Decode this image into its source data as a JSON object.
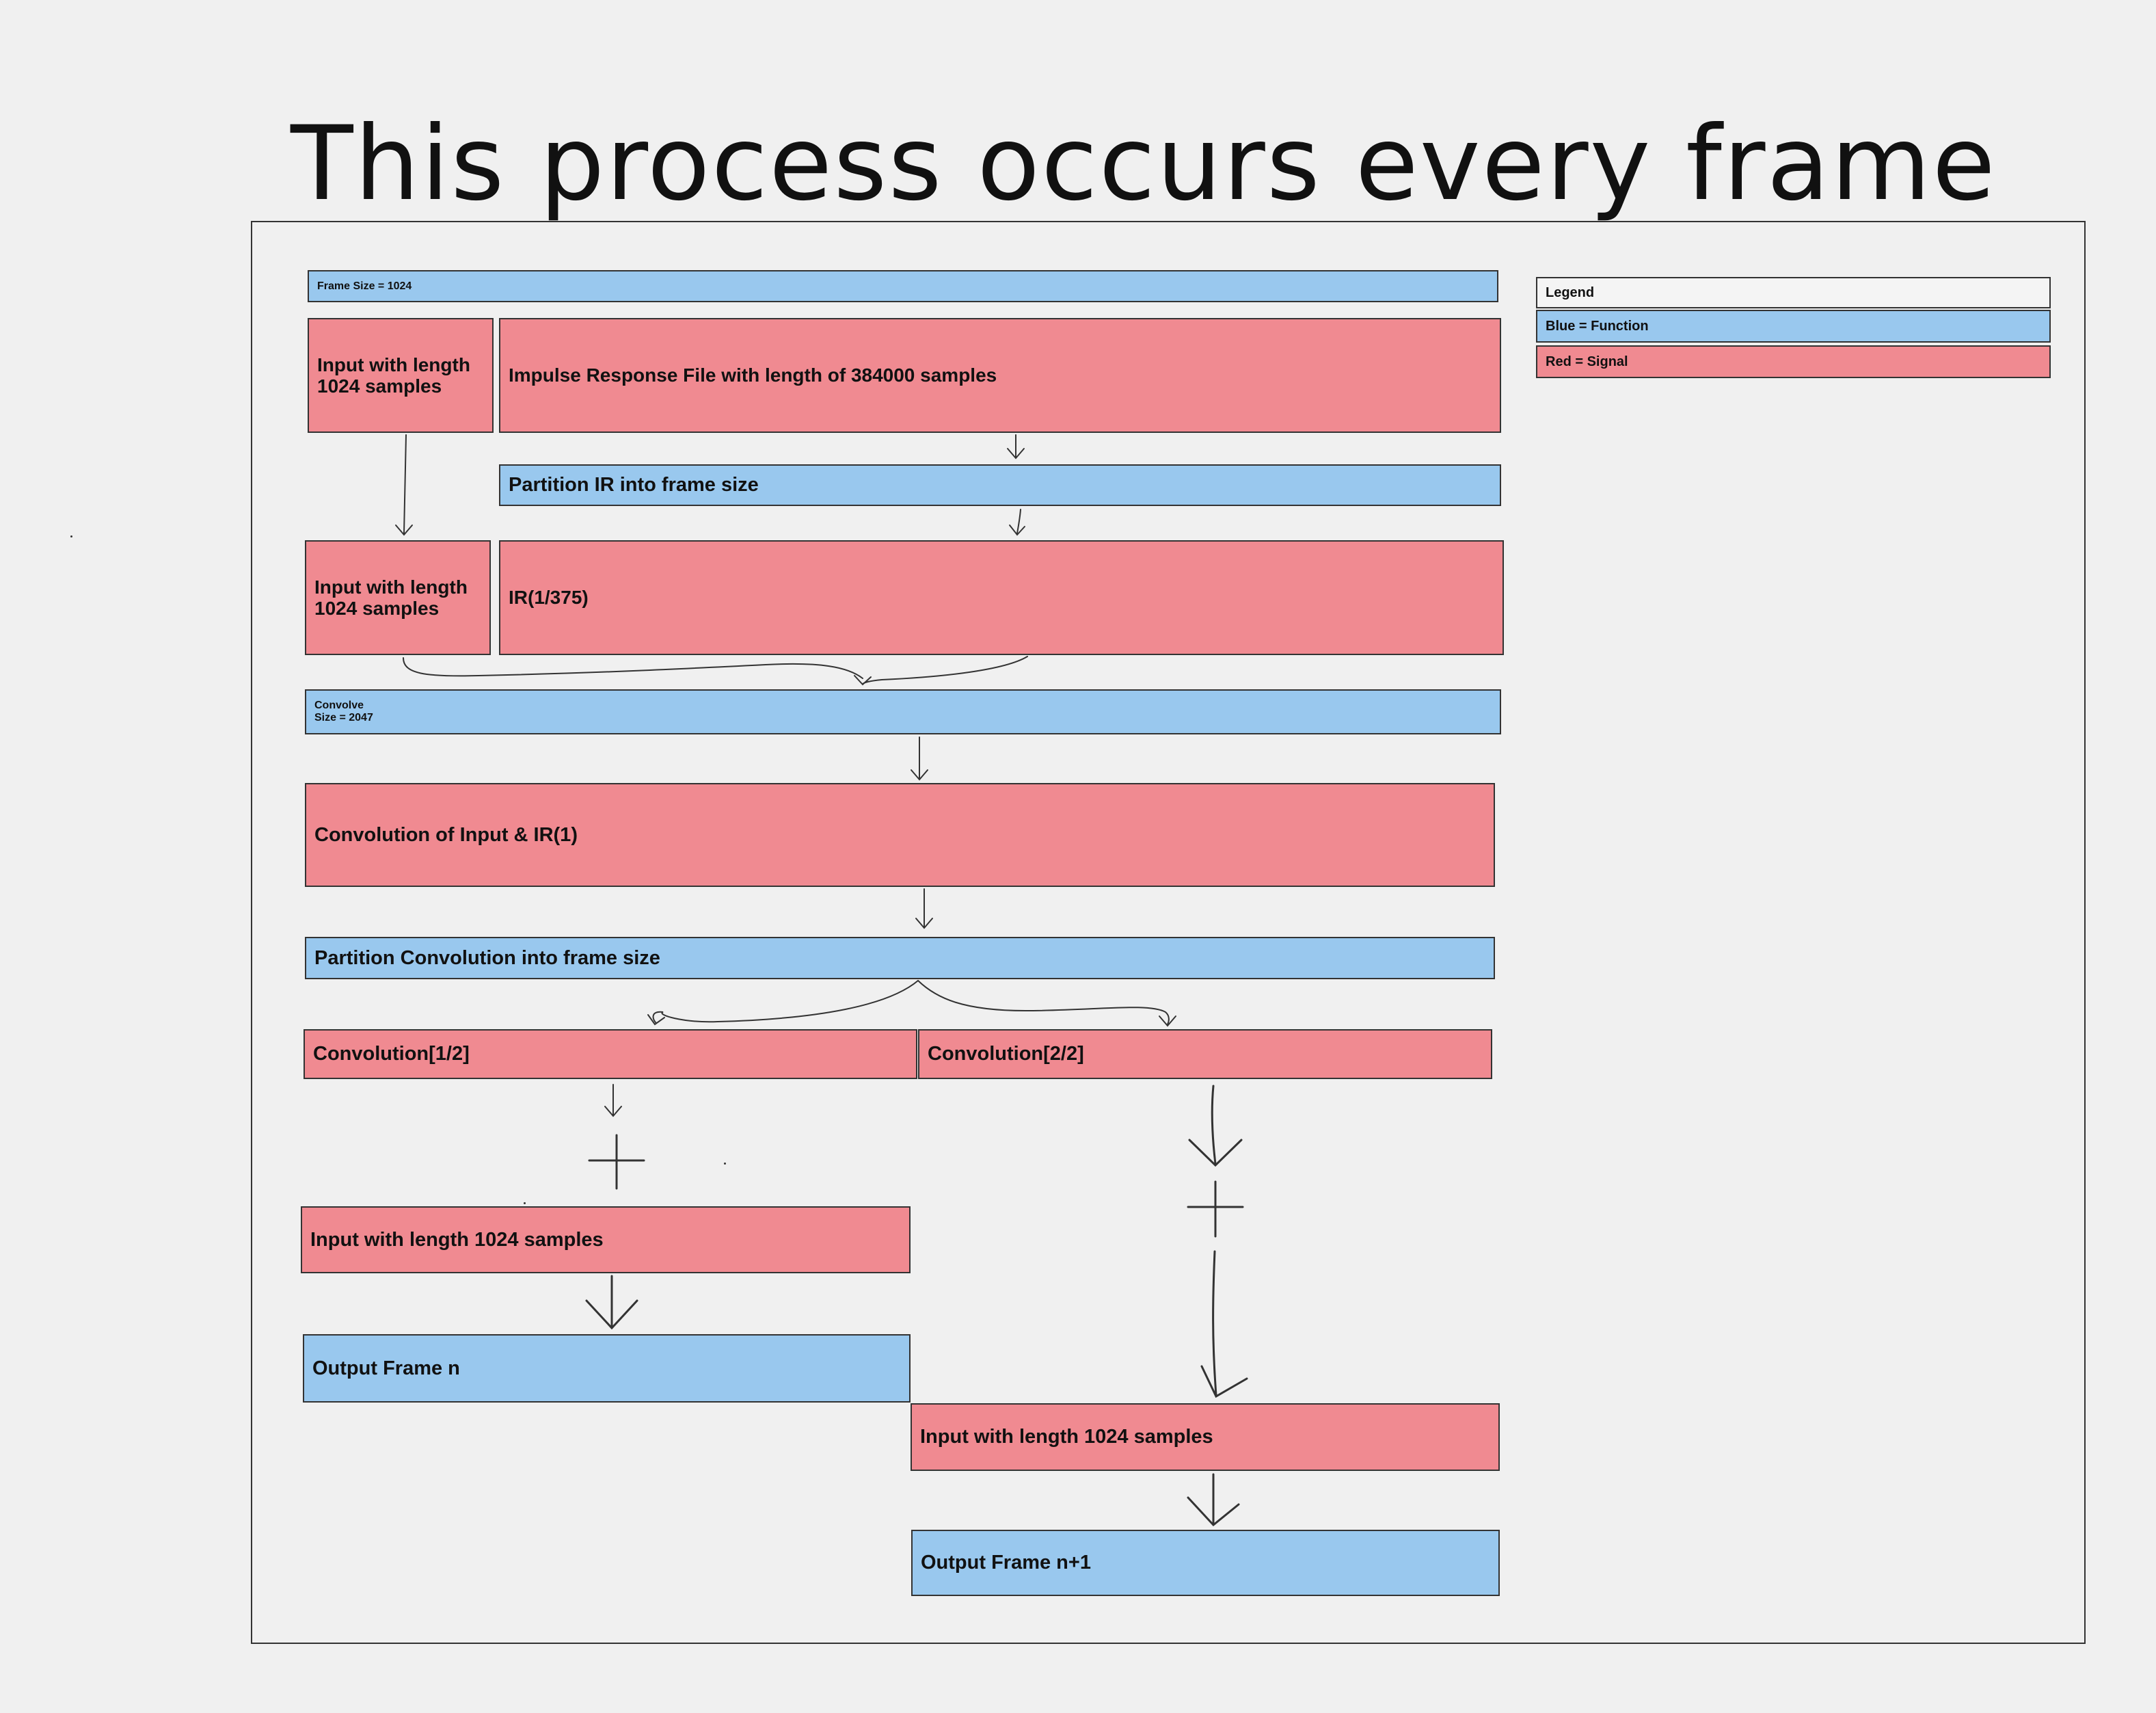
{
  "title": "This process occurs every frame",
  "legend": {
    "heading": "Legend",
    "blue": "Blue = Function",
    "red": "Red = Signal"
  },
  "nodes": {
    "frame_size": "Frame Size = 1024",
    "input_top": "Input with length 1024 samples",
    "impulse_response": "Impulse Response File with length of 384000 samples",
    "partition_ir": "Partition IR into frame size",
    "input_second": "Input with length 1024 samples",
    "ir_part": "IR(1/375)",
    "convolve_line1": "Convolve",
    "convolve_line2": "Size = 2047",
    "convolution_result": "Convolution of Input & IR(1)",
    "partition_convolution": "Partition Convolution into frame size",
    "conv_half_1": "Convolution[1/2]",
    "conv_half_2": "Convolution[2/2]",
    "input_left": "Input with length 1024 samples",
    "output_n": "Output Frame n",
    "input_right": "Input with length 1024 samples",
    "output_n1": "Output Frame n+1"
  },
  "colors": {
    "signal": "#f08a91",
    "function": "#99c8ee",
    "background": "#f0f0f0"
  }
}
